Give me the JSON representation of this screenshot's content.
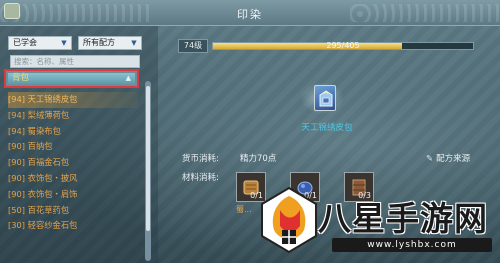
{
  "window": {
    "title": "印染"
  },
  "filters": {
    "learned": "已学会",
    "recipe_type": "所有配方"
  },
  "search": {
    "placeholder": "搜索：名称、属性"
  },
  "category": {
    "label": "背包"
  },
  "recipes": [
    {
      "label": "[94] 天工锦绣皮包",
      "selected": true
    },
    {
      "label": "[94] 梨绒薄荷包",
      "selected": false
    },
    {
      "label": "[94] 蜀染布包",
      "selected": false
    },
    {
      "label": "[90] 百纳包",
      "selected": false
    },
    {
      "label": "[90] 百福金石包",
      "selected": false
    },
    {
      "label": "[90] 衣饰包・披风",
      "selected": false
    },
    {
      "label": "[90] 衣饰包・肩饰",
      "selected": false
    },
    {
      "label": "[50] 百花草药包",
      "selected": false
    },
    {
      "label": "[30] 轻容纱金石包",
      "selected": false
    }
  ],
  "level": {
    "label": "74级",
    "xp_text": "295/405",
    "progress": 0.728
  },
  "product": {
    "name": "天工锦绣皮包",
    "icon": "backpack-icon"
  },
  "costs": {
    "currency_label": "货币消耗:",
    "currency_value": "精力70点",
    "materials_label": "材料消耗:",
    "recipe_source": "配方来源"
  },
  "materials": [
    {
      "count": "0/1",
      "name": "蜀...",
      "icon": "leather-icon",
      "color": "#b8823c"
    },
    {
      "count": "0/1",
      "name": "",
      "icon": "blue-dye-icon",
      "color": "#3a5fb0"
    },
    {
      "count": "0/3",
      "name": "",
      "icon": "cloth-icon",
      "color": "#8a5a3a"
    }
  ],
  "watermark": {
    "text": "八星手游网",
    "url": "www.lyshbx.com"
  },
  "colors": {
    "accent_gold": "#e5a24a",
    "highlight_red": "#d93a43",
    "product_cyan": "#50c7e6"
  }
}
